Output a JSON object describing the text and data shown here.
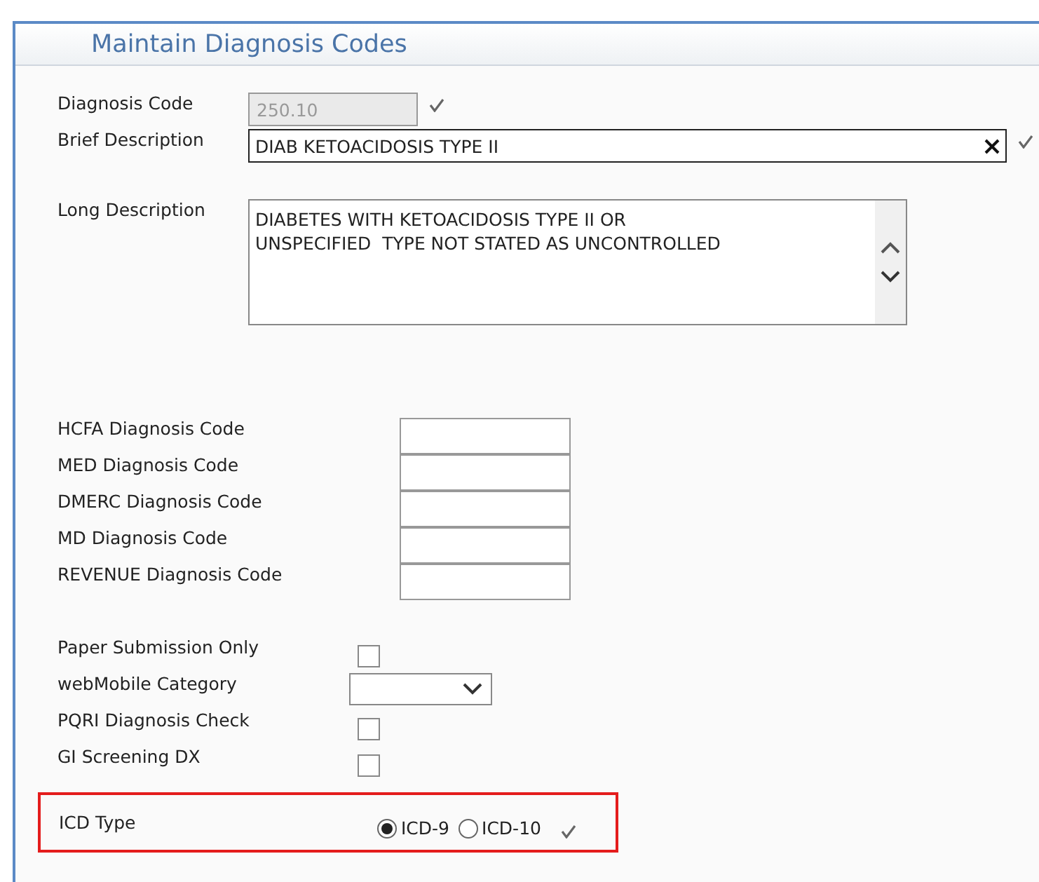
{
  "title": "Maintain Diagnosis Codes",
  "diagnosis_code": {
    "label": "Diagnosis Code",
    "value": "250.10",
    "disabled": true
  },
  "brief_description": {
    "label": "Brief Description",
    "value": "DIAB KETOACIDOSIS TYPE II"
  },
  "long_description": {
    "label": "Long Description",
    "value": "DIABETES WITH KETOACIDOSIS TYPE II OR\nUNSPECIFIED  TYPE NOT STATED AS UNCONTROLLED"
  },
  "code_fields": [
    {
      "label": "HCFA Diagnosis Code"
    },
    {
      "label": "MED Diagnosis Code"
    },
    {
      "label": "DMERC Diagnosis Code"
    },
    {
      "label": "MD Diagnosis Code"
    },
    {
      "label": "REVENUE Diagnosis Code"
    }
  ],
  "options": [
    {
      "kind": "checkbox",
      "label": "Paper Submission Only",
      "checked": false
    },
    {
      "kind": "select",
      "label": "webMobile Category"
    },
    {
      "kind": "checkbox",
      "label": "PQRI Diagnosis Check",
      "checked": false
    },
    {
      "kind": "checkbox",
      "label": "GI Screening DX",
      "checked": false
    }
  ],
  "icd_type": {
    "label": "ICD Type",
    "choices": [
      {
        "label": "ICD-9",
        "selected": true
      },
      {
        "label": "ICD-10",
        "selected": false
      }
    ]
  }
}
